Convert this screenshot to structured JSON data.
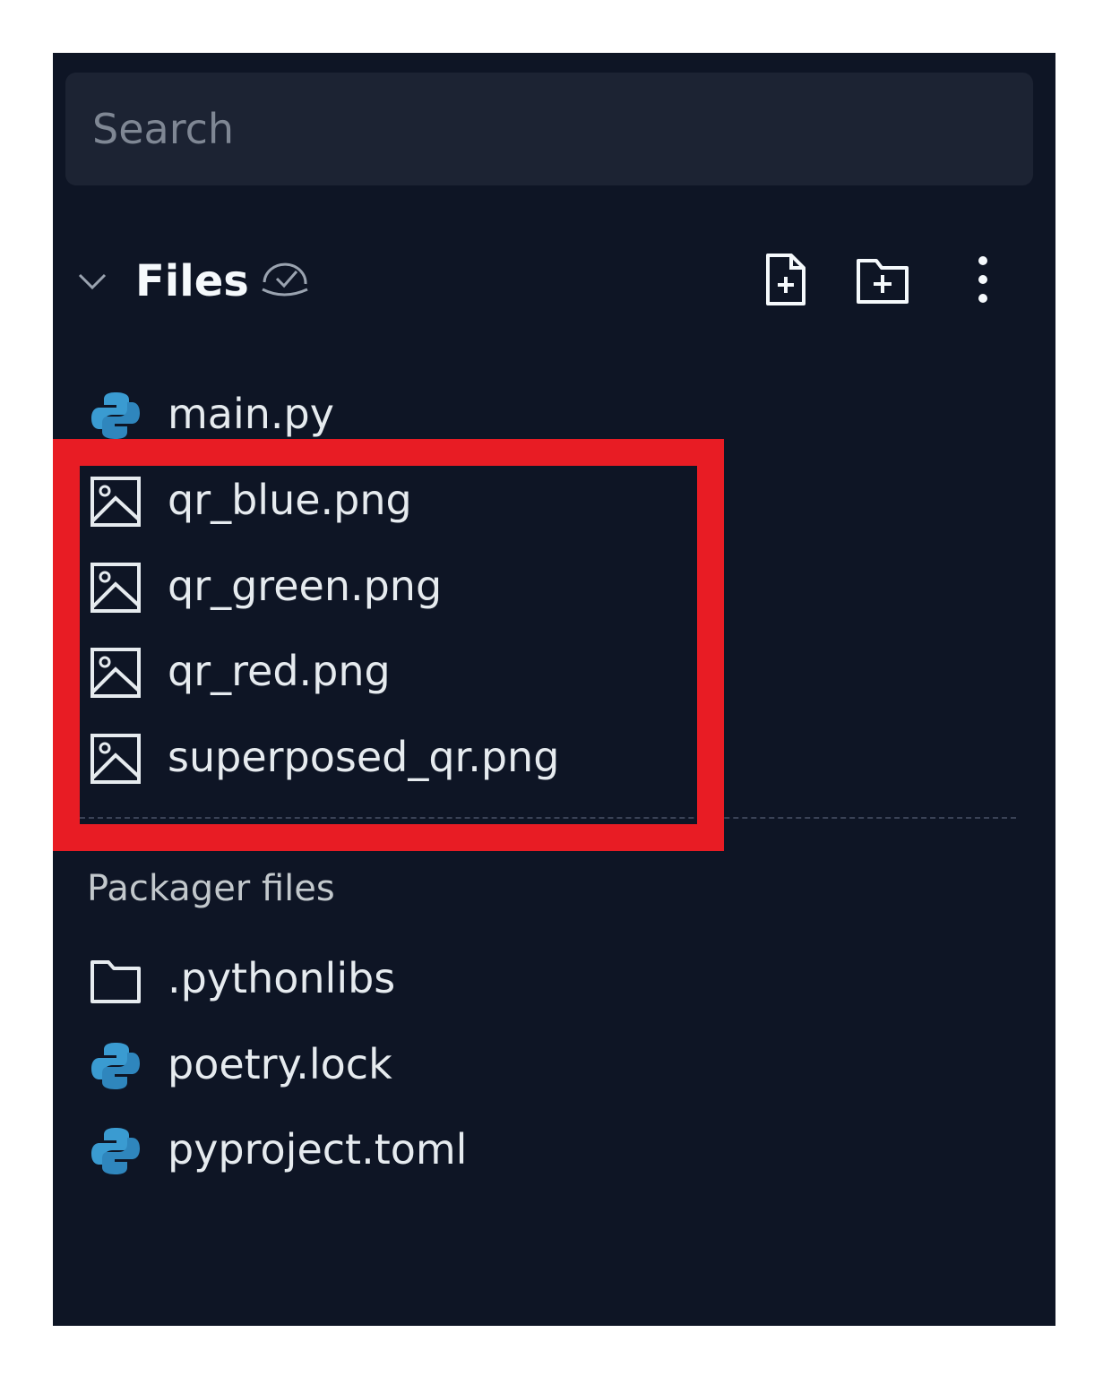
{
  "search": {
    "placeholder": "Search"
  },
  "files_section": {
    "title": "Files",
    "items": [
      {
        "name": "main.py",
        "icon": "python-icon"
      },
      {
        "name": "qr_blue.png",
        "icon": "image-icon"
      },
      {
        "name": "qr_green.png",
        "icon": "image-icon"
      },
      {
        "name": "qr_red.png",
        "icon": "image-icon"
      },
      {
        "name": "superposed_qr.png",
        "icon": "image-icon"
      }
    ]
  },
  "packager_section": {
    "label": "Packager files",
    "items": [
      {
        "name": ".pythonlibs",
        "icon": "folder-icon"
      },
      {
        "name": "poetry.lock",
        "icon": "python-icon"
      },
      {
        "name": "pyproject.toml",
        "icon": "python-icon"
      }
    ]
  },
  "colors": {
    "panel_bg": "#0e1525",
    "search_bg": "#1c2333",
    "highlight": "#e81c24",
    "python_icon": "#3a9bd1"
  }
}
